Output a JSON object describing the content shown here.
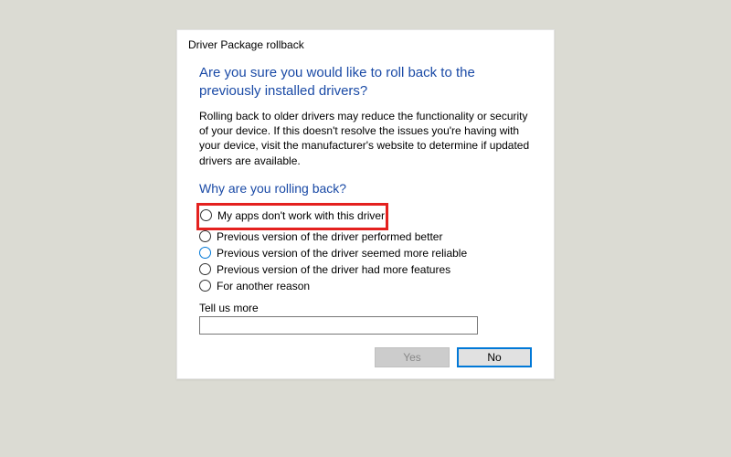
{
  "dialog": {
    "title": "Driver Package rollback",
    "question": "Are you sure you would like to roll back to the previously installed drivers?",
    "warning": "Rolling back to older drivers may reduce the functionality or security of your device.  If this doesn't resolve the issues you're having with your device, visit the manufacturer's website to determine if updated drivers are available.",
    "subhead": "Why are you rolling back?",
    "options": [
      {
        "label": "My apps don't work with this driver",
        "highlighted": true,
        "selected": false
      },
      {
        "label": "Previous version of the driver performed better",
        "highlighted": false,
        "selected": false
      },
      {
        "label": "Previous version of the driver seemed more reliable",
        "highlighted": false,
        "selected": true
      },
      {
        "label": "Previous version of the driver had more features",
        "highlighted": false,
        "selected": false
      },
      {
        "label": "For another reason",
        "highlighted": false,
        "selected": false
      }
    ],
    "tell_label": "Tell us more",
    "tell_value": "",
    "buttons": {
      "yes": "Yes",
      "no": "No"
    }
  }
}
